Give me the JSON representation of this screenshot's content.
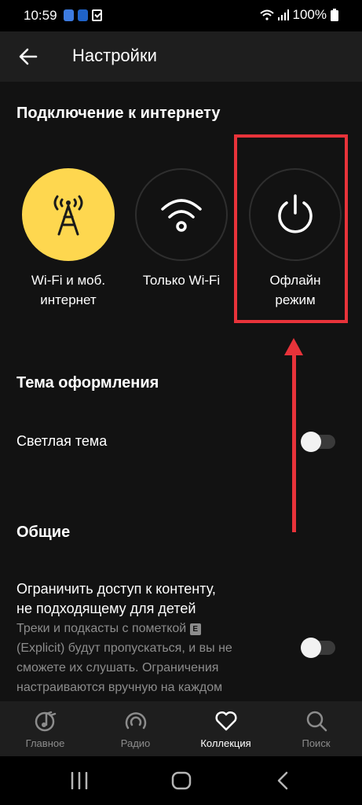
{
  "status_bar": {
    "time": "10:59",
    "battery": "100%",
    "icons": [
      "notification-app-icon",
      "notification-app-icon",
      "checkbox-notification-icon",
      "wifi-icon",
      "signal-icon",
      "battery-icon"
    ]
  },
  "header": {
    "title": "Настройки",
    "back_icon": "back-arrow-icon"
  },
  "internet": {
    "title": "Подключение к интернету",
    "modes": [
      {
        "line1": "Wi-Fi и моб.",
        "line2": "интернет",
        "icon": "antenna-icon",
        "selected": true
      },
      {
        "line1": "Только Wi-Fi",
        "line2": "",
        "icon": "wifi-icon",
        "selected": false
      },
      {
        "line1": "Офлайн",
        "line2": "режим",
        "icon": "power-icon",
        "selected": false
      }
    ]
  },
  "theme": {
    "title": "Тема оформления",
    "light_label": "Светлая тема",
    "light_on": false
  },
  "general": {
    "title": "Общие",
    "content_title_1": "Ограничить доступ к контенту,",
    "content_title_2": "не подходящему для детей",
    "desc_1": "Треки и подкасты с пометкой",
    "badge": "E",
    "desc_2": "(Explicit) будут пропускаться, и вы не",
    "desc_3": "сможете их слушать. Ограничения",
    "desc_4": "настраиваются вручную на каждом",
    "content_on": false
  },
  "bottom_nav": {
    "items": [
      {
        "label": "Главное",
        "icon": "music-note-icon"
      },
      {
        "label": "Радио",
        "icon": "radio-icon"
      },
      {
        "label": "Коллекция",
        "icon": "heart-icon",
        "active": true
      },
      {
        "label": "Поиск",
        "icon": "search-icon"
      }
    ]
  },
  "system_nav": {
    "icons": [
      "recent-apps-icon",
      "home-icon",
      "back-icon"
    ]
  },
  "colors": {
    "background": "#121212",
    "accent": "#fed74f",
    "annotation": "#e8333a"
  }
}
